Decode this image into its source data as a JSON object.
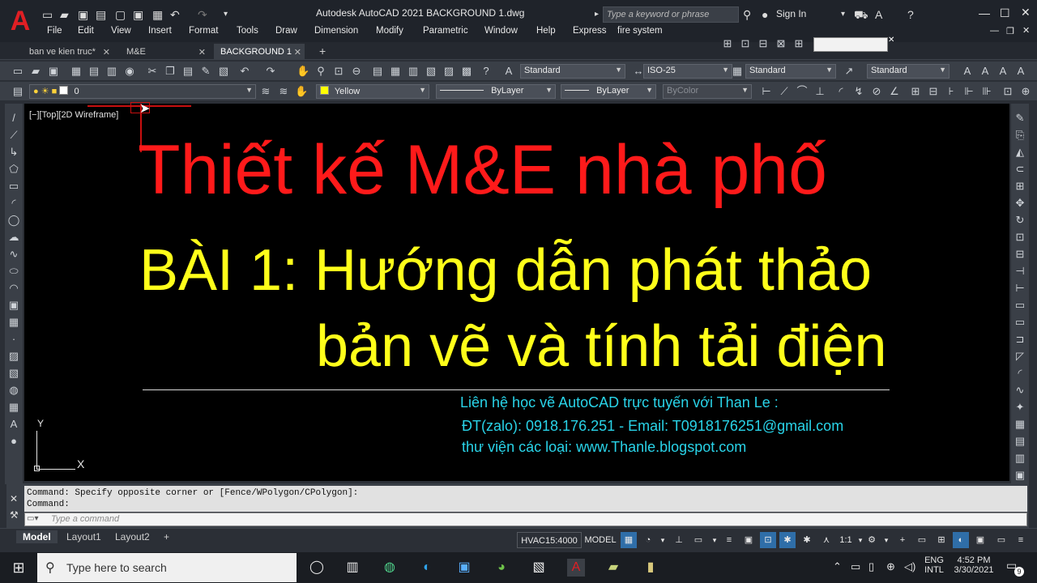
{
  "window": {
    "app_title": "Autodesk AutoCAD 2021    BACKGROUND 1.dwg",
    "search_placeholder": "Type a keyword or phrase",
    "sign_in": "Sign In"
  },
  "menu": [
    "File",
    "Edit",
    "View",
    "Insert",
    "Format",
    "Tools",
    "Draw",
    "Dimension",
    "Modify",
    "Parametric",
    "Window",
    "Help",
    "Express",
    "fire system"
  ],
  "tabs": [
    {
      "label": "ban ve kien truc*"
    },
    {
      "label": "M&E"
    },
    {
      "label": "BACKGROUND 1",
      "active": true
    }
  ],
  "toolbar1": {
    "text_style": "Standard",
    "dim_style": "ISO-25",
    "table_style": "Standard",
    "multileader_style": "Standard"
  },
  "toolbar2": {
    "layer": "0",
    "color": "Yellow",
    "color_hex": "#ffff00",
    "linetype": "ByLayer",
    "lineweight": "ByLayer",
    "plotstyle": "ByColor"
  },
  "canvas": {
    "viewport_label": "[−][Top][2D Wireframe]",
    "title": "Thiết kế M&E nhà phố",
    "lesson_line1": "BÀI 1: Hướng dẫn phát thảo",
    "lesson_line2": "bản vẽ và tính tải điện",
    "contact_line1": "Liên hệ học vẽ AutoCAD trực tuyến với Than Le :",
    "contact_line2": "ĐT(zalo): 0918.176.251    - Email: T0918176251@gmail.com",
    "contact_line3": "thư viện các loại:  www.Thanle.blogspot.com",
    "ucs_x": "X",
    "ucs_y": "Y",
    "colors": {
      "title": "#ff1a1a",
      "lesson": "#ffff1a",
      "contact": "#29d3e8"
    }
  },
  "command": {
    "history_line1": "Command: Specify opposite corner or [Fence/WPolygon/CPolygon]:",
    "history_line2": "Command:",
    "placeholder": "Type a command"
  },
  "status": {
    "layouts": [
      "Model",
      "Layout1",
      "Layout2"
    ],
    "ucs_name": "HVAC15:4000",
    "space": "MODEL",
    "scale": "1:1"
  },
  "taskbar": {
    "search_placeholder": "Type here to search",
    "lang": "ENG",
    "lang2": "INTL",
    "time": "4:52 PM",
    "date": "3/30/2021",
    "notif_count": "9"
  }
}
